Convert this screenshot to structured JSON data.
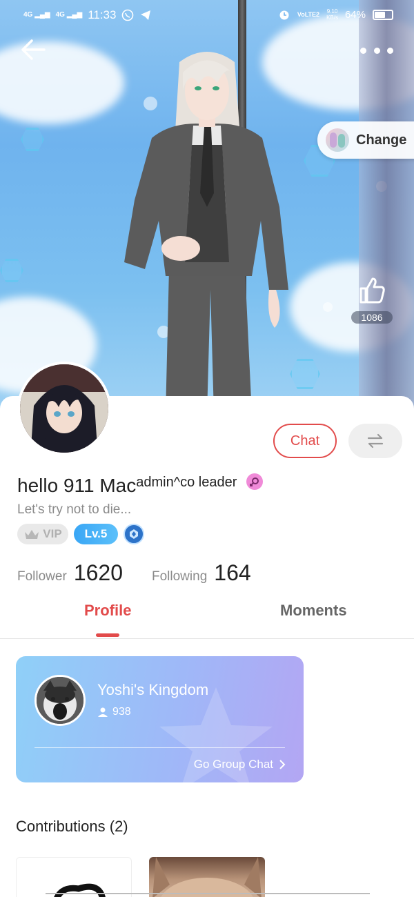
{
  "status_bar": {
    "network1": "4G",
    "network2": "4G",
    "time": "11:33",
    "volte": "VoLTE2",
    "speed": "9.10",
    "speed_unit": "KB/s",
    "battery": "64%",
    "battery_level": 0.64
  },
  "hero": {
    "change_label": "Change",
    "like_count": "1086"
  },
  "actions": {
    "chat_label": "Chat"
  },
  "profile": {
    "name": "hello 911 Mac",
    "title_sup": "admin^co leader",
    "bio": "Let's try not to die...",
    "vip_label": "VIP",
    "level_label": "Lv.5",
    "follower_label": "Follower",
    "follower_count": "1620",
    "following_label": "Following",
    "following_count": "164"
  },
  "tabs": {
    "profile": "Profile",
    "moments": "Moments"
  },
  "group": {
    "name": "Yoshi's Kingdom",
    "members": "938",
    "cta": "Go Group Chat"
  },
  "contributions": {
    "label": "Contributions (2)"
  },
  "colors": {
    "accent": "#e24b4b",
    "level_blue": "#39a6f5",
    "card_start": "#8fd0f8",
    "card_end": "#b3a6f3"
  }
}
